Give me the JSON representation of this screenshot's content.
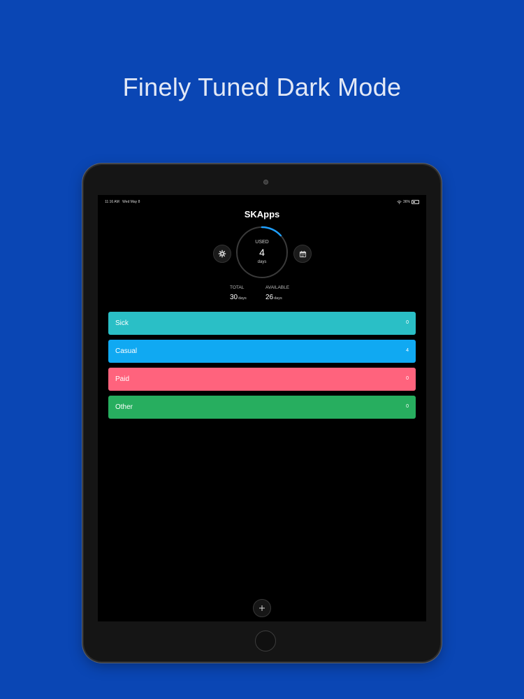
{
  "headline": "Finely Tuned Dark Mode",
  "status_bar": {
    "time": "11:16 AM",
    "date": "Wed May 8",
    "battery": "36%",
    "icons": [
      "wifi-icon",
      "battery-icon"
    ]
  },
  "app": {
    "title": "SKApps",
    "used": {
      "label": "USED",
      "value": "4",
      "unit": "days",
      "progress": 0.1333
    },
    "stats": {
      "total": {
        "label": "TOTAL",
        "value": "30",
        "unit": "days"
      },
      "available": {
        "label": "AVAILABLE",
        "value": "26",
        "unit": "days"
      }
    },
    "leave_types": [
      {
        "name": "Sick",
        "count": "0",
        "color": "#2abfc6"
      },
      {
        "name": "Casual",
        "count": "4",
        "color": "#10a9f2"
      },
      {
        "name": "Paid",
        "count": "0",
        "color": "#ff637d"
      },
      {
        "name": "Other",
        "count": "0",
        "color": "#27ae5f"
      }
    ],
    "icons": {
      "settings": "gear-icon",
      "calendar": "calendar-icon",
      "add": "plus-icon"
    }
  },
  "colors": {
    "background": "#0a46b4",
    "ring_progress": "#1fa0ff",
    "screen": "#000000"
  }
}
